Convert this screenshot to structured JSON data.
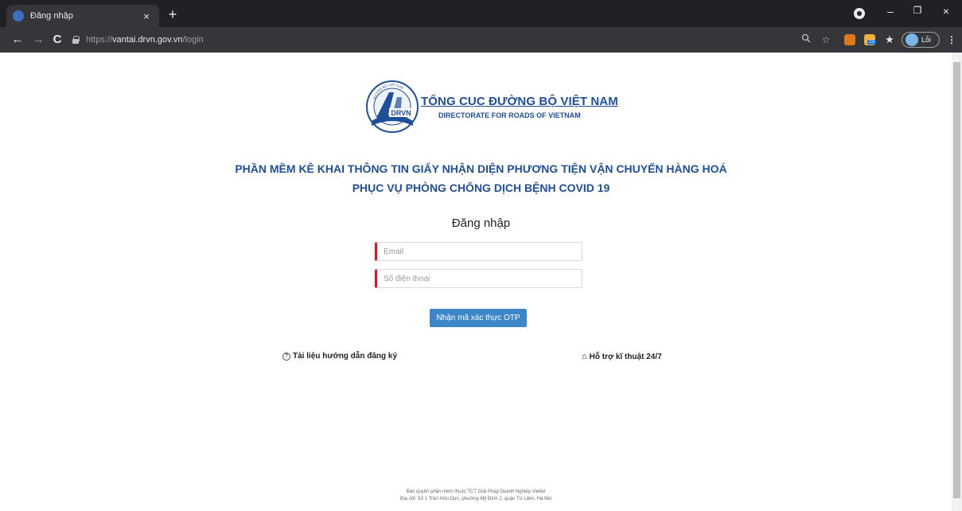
{
  "browser": {
    "tab_title": "Đăng nhập",
    "tab_close": "×",
    "new_tab": "+",
    "url_protocol": "https://",
    "url_host": "vantai.drvn.gov.vn",
    "url_path": "/login",
    "profile_label": "Lỗi",
    "nav_back": "←",
    "nav_forward": "→",
    "nav_reload": "C",
    "zoom_icon": "search-icon",
    "bookmark_icon": "star-icon",
    "extensions_icon": "puzzle-icon",
    "menu_icon": "kebab-icon",
    "window_minimize": "–",
    "window_restore": "❐",
    "window_close": "×",
    "extension_badge": "23"
  },
  "logo": {
    "title": "TỔNG CỤC ĐƯỜNG BỘ VIỆT NAM",
    "subtitle": "DIRECTORATE FOR ROADS OF VIETNAM",
    "emblem_ring_text": "ĐƯỜNG BỘ VIỆT NAM",
    "emblem_initials": "DRVN"
  },
  "app": {
    "title_line1": "PHẦN MỀM KÊ KHAI THÔNG TIN GIẤY NHẬN DIỆN PHƯƠNG TIỆN VẬN CHUYỂN HÀNG HOÁ",
    "title_line2": "PHỤC VỤ PHÒNG CHỐNG DỊCH BỆNH COVID 19"
  },
  "login": {
    "heading": "Đăng nhập",
    "email_placeholder": "Email",
    "email_value": "",
    "phone_placeholder": "Số điện thoại",
    "phone_value": "",
    "otp_button": "Nhận mã xác thực OTP"
  },
  "links": {
    "guide": "Tài liệu hướng dẫn đăng ký",
    "guide_icon": "question-circle-icon",
    "support": "Hỗ trợ kĩ thuật 24/7",
    "support_icon": "home-icon"
  },
  "footer": {
    "line1": "Bản quyền phần mềm thuộc TCT Giải Pháp Doanh Nghiệp Viettel",
    "line2": "Địa chỉ: Số 1 Trần Hữu Dực, phường Mỹ Đình 2, quận Từ Liêm, Hà Nội"
  },
  "colors": {
    "brand_blue": "#1f4e9b",
    "button_blue": "#3c86c8",
    "required_red": "#e0141e"
  }
}
